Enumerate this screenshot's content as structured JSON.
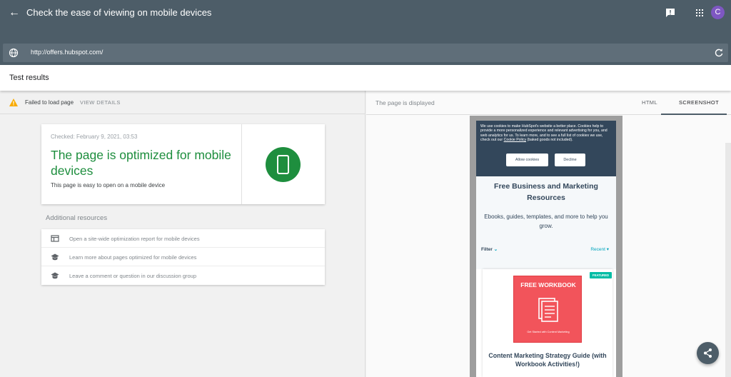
{
  "header": {
    "title": "Check the ease of viewing on mobile devices",
    "avatar_letter": "C"
  },
  "url_bar": {
    "url": "http://offers.hubspot.com/"
  },
  "results": {
    "title": "Test results"
  },
  "left_panel": {
    "fail_text": "Failed to load page",
    "view_details": "VIEW DETAILS",
    "result_card": {
      "checked": "Checked: February 9, 2021, 03:53",
      "headline": "The page is optimized for mobile devices",
      "subtext": "This page is easy to open on a mobile device"
    },
    "additional_resources_title": "Additional resources",
    "resources": [
      {
        "label": "Open a site-wide optimization report for mobile devices",
        "icon": "report-icon"
      },
      {
        "label": "Learn more about pages optimized for mobile devices",
        "icon": "school-icon"
      },
      {
        "label": "Leave a comment or question in our discussion group",
        "icon": "school-icon"
      }
    ]
  },
  "right_panel": {
    "displayed_text": "The page is displayed",
    "tabs": [
      {
        "label": "HTML",
        "active": false
      },
      {
        "label": "SCREENSHOT",
        "active": true
      }
    ],
    "preview": {
      "cookie_text": "We use cookies to make HubSpot's website a better place. Cookies help to provide a more personalized experience and relevant advertising for you, and web analytics for us. To learn more, and to see a full list of cookies we use, check out our",
      "cookie_link": "Cookie Policy",
      "cookie_text_end": "(baked goods not included).",
      "allow_label": "Allow cookies",
      "decline_label": "Decline",
      "hero_title": "Free Business and Marketing Resources",
      "hero_subtitle": "Ebooks, guides, templates, and more to help you grow.",
      "filter_label": "Filter",
      "recent_label": "Recent",
      "featured_badge": "FEATURED",
      "workbook_title": "FREE WORKBOOK",
      "workbook_caption": "Get Started with Content Marketing",
      "card_title": "Content Marketing Strategy Guide (with Workbook Activities!)"
    }
  },
  "colors": {
    "header_bg": "#4d5d68",
    "success_green": "#1e8e3e",
    "warning_yellow": "#f9ab00",
    "hubspot_navy": "#33475b",
    "hubspot_teal": "#00bda5",
    "workbook_red": "#f2545b",
    "avatar_purple": "#7e57c2"
  }
}
